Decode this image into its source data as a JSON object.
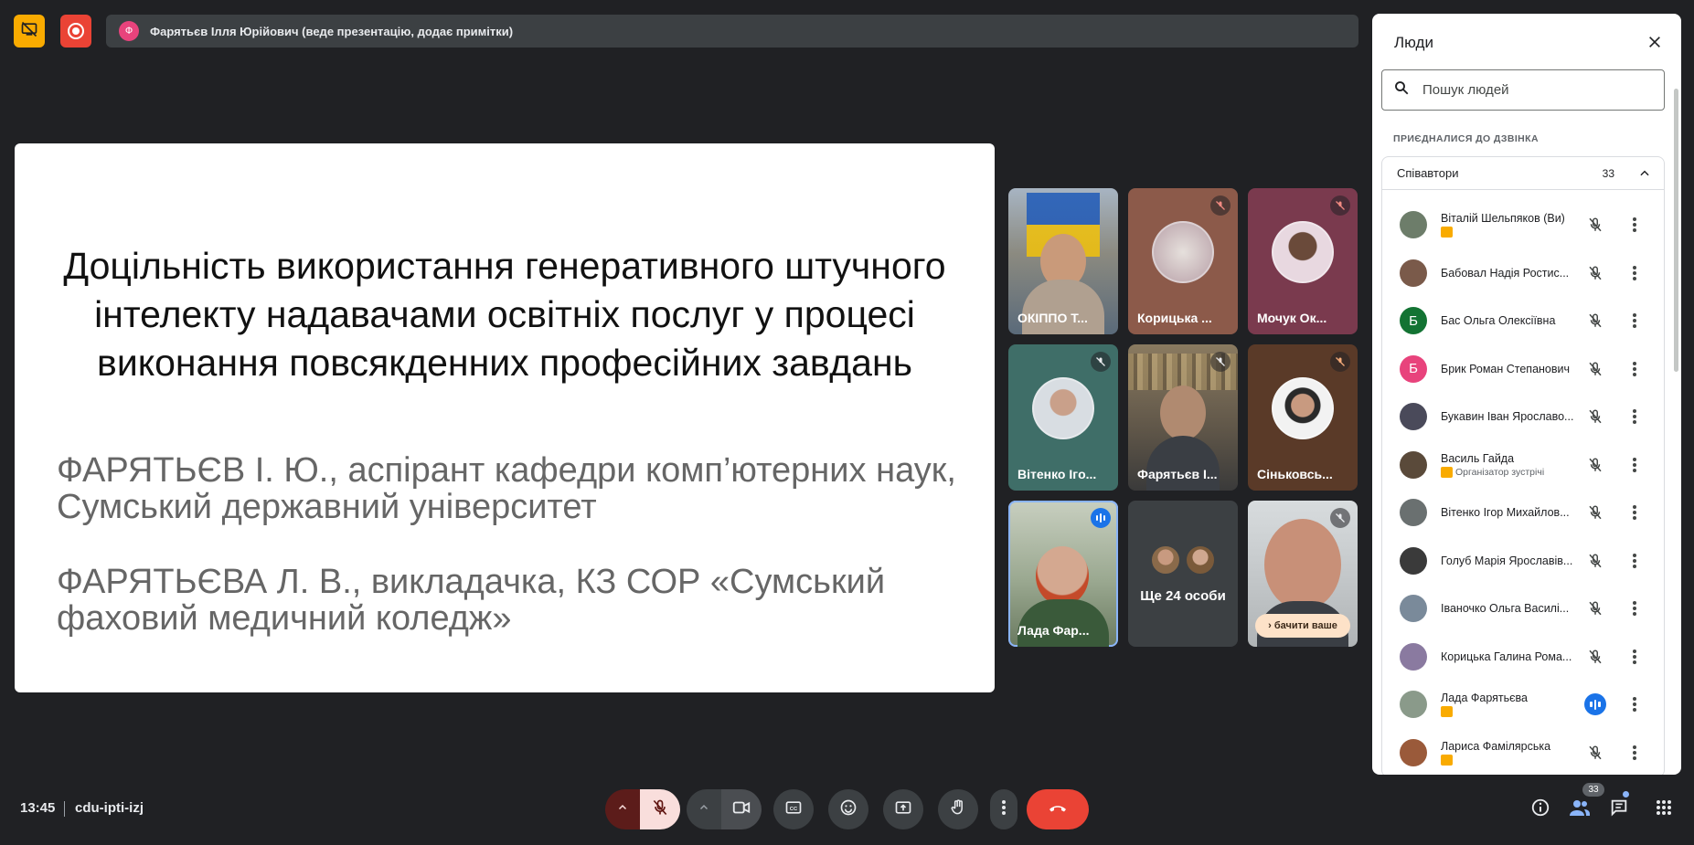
{
  "presenter_bar": {
    "avatar_letter": "Ф",
    "text": "Фарятьєв Ілля Юрійович (веде презентацію, додає примітки)"
  },
  "slide": {
    "title": "Доцільність використання генеративного штучного інтелекту надавачами освітніх послуг у процесі виконання повсякденних професійних завдань",
    "author1": "ФАРЯТЬЄВ І. Ю., аспірант кафедри комп’ютерних наук, Сумський державний університет",
    "author2": "ФАРЯТЬЄВА Л. В., викладачка, КЗ СОР «Сумський фаховий медичний коледж»"
  },
  "tiles": [
    {
      "name": "ОКІППО Т...",
      "muted": false,
      "bg": "#6b7f9a"
    },
    {
      "name": "Корицька ...",
      "muted": true,
      "bg": "#8c5a4a"
    },
    {
      "name": "Мочук Ок...",
      "muted": true,
      "bg": "#7a3a4e"
    },
    {
      "name": "Вітенко Ігo...",
      "muted": true,
      "bg": "#3f6e68"
    },
    {
      "name": "Фарятьєв І...",
      "muted": true,
      "bg": "#5e5548"
    },
    {
      "name": "Сіньковсь...",
      "muted": true,
      "bg": "#5a3a28"
    },
    {
      "name": "Лада Фар...",
      "speaking": true,
      "bg": "#8a9a7a"
    },
    {
      "more": "Ще 24 особи"
    },
    {
      "see_you": "› бачити ваше",
      "muted": true,
      "bg": "#6a6e72"
    }
  ],
  "people_panel": {
    "title": "Люди",
    "search_placeholder": "Пошук людей",
    "section_label": "ПРИЄДНАЛИСЯ ДО ДЗВІНКА",
    "group_title": "Співавтори",
    "group_count": "33",
    "people": [
      {
        "name": "Віталій Шельпяков (Ви)",
        "badge": true,
        "avatar_color": "#6d7d6a"
      },
      {
        "name": "Бабовал Надія Ростис...",
        "avatar_color": "#7a5a4a"
      },
      {
        "name": "Бас Ольга Олексіївна",
        "letter": "Б",
        "avatar_color": "#137333"
      },
      {
        "name": "Брик Роман Степанович",
        "letter": "Б",
        "avatar_color": "#e8437c"
      },
      {
        "name": "Букавин Іван Ярославо...",
        "avatar_color": "#4a4a5a"
      },
      {
        "name": "Василь Гайда",
        "badge": true,
        "role": "Організатор зустрічі",
        "avatar_color": "#5a4a3a"
      },
      {
        "name": "Вітенко Ігор Михайлов...",
        "avatar_color": "#6a7070"
      },
      {
        "name": "Голуб Марія Ярославів...",
        "avatar_color": "#3a3a3a"
      },
      {
        "name": "Іваночко Ольга Василі...",
        "avatar_color": "#7a8a9a"
      },
      {
        "name": "Корицька Галина Рома...",
        "avatar_color": "#8a7aa0"
      },
      {
        "name": "Лада Фарятьєва",
        "badge": true,
        "speaking": true,
        "avatar_color": "#8a9a8a"
      },
      {
        "name": "Лариса Фамілярська",
        "badge": true,
        "avatar_color": "#9a5a3a"
      }
    ]
  },
  "bottom_bar": {
    "time": "13:45",
    "meeting_code": "cdu-ipti-izj",
    "people_count": "33"
  },
  "colors": {
    "background": "#202124",
    "accent_blue": "#1a73e8",
    "end_call_red": "#ea4335",
    "badge_yellow": "#f9ab00"
  }
}
